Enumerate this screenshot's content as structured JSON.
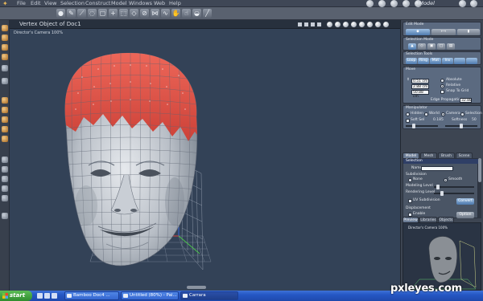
{
  "menu": {
    "items": [
      "File",
      "Edit",
      "View",
      "Selection",
      "Construct",
      "Model",
      "Windows",
      "Web",
      "Help"
    ],
    "app_name": "Model"
  },
  "viewport": {
    "title": "Vertex Object of Doc1",
    "camera_label": "Director's Camera 100%"
  },
  "panel": {
    "edit_mode_label": "Edit Mode",
    "selection_mode_label": "Selection Mode",
    "selection_tools_label": "Selection Tools",
    "selection_tools": [
      "Loop",
      "Ring",
      "Mat",
      "Inv",
      "",
      ""
    ],
    "move_label": "Move",
    "move_values": [
      "0.51 cm",
      "2.88 cm",
      "50.88 cm"
    ],
    "move_options": [
      "Absolute",
      "Relative",
      "Snap To Grid"
    ],
    "edge_propagation_label": "Edge Propagation",
    "edge_propagation_value": "32.88",
    "manipulator_label": "Manipulator",
    "manipulator_options": [
      "Hidden",
      "World",
      "Camera",
      "Selection"
    ],
    "soft_sel_label": "Soft Sel",
    "soft_sel_value": "0.185",
    "softness_label": "Softness",
    "softness_value": "50"
  },
  "inspector": {
    "tabs": [
      "Model",
      "Mesh",
      "Brush",
      "Scene"
    ],
    "header": "Selection",
    "name_label": "Name",
    "name_value": "",
    "subdivision_label": "Subdivision",
    "subdivision_options": [
      "None",
      "Smooth"
    ],
    "modeling_level_label": "Modeling Level",
    "rendering_level_label": "Rendering Level",
    "uv_subdivision_label": "UV Subdivision",
    "convert_label": "Convert",
    "displacement_label": "Displacement",
    "enable_label": "Enable",
    "option_label": "Option"
  },
  "preview": {
    "tabs": [
      "Preview",
      "Libraries",
      "Objects"
    ],
    "camera_label": "Director's Camera 100%"
  },
  "taskbar": {
    "start_label": "start",
    "tasks": [
      "Bamboo Doc4 ...",
      "Untitled (80%) - Pai...",
      "Carrara"
    ]
  },
  "watermark": "pxleyes.com",
  "colors": {
    "viewport_bg": "#334257",
    "mesh": "#c2c6cc",
    "selected_vertices": "#e0433a",
    "accent": "#4d79ad"
  }
}
